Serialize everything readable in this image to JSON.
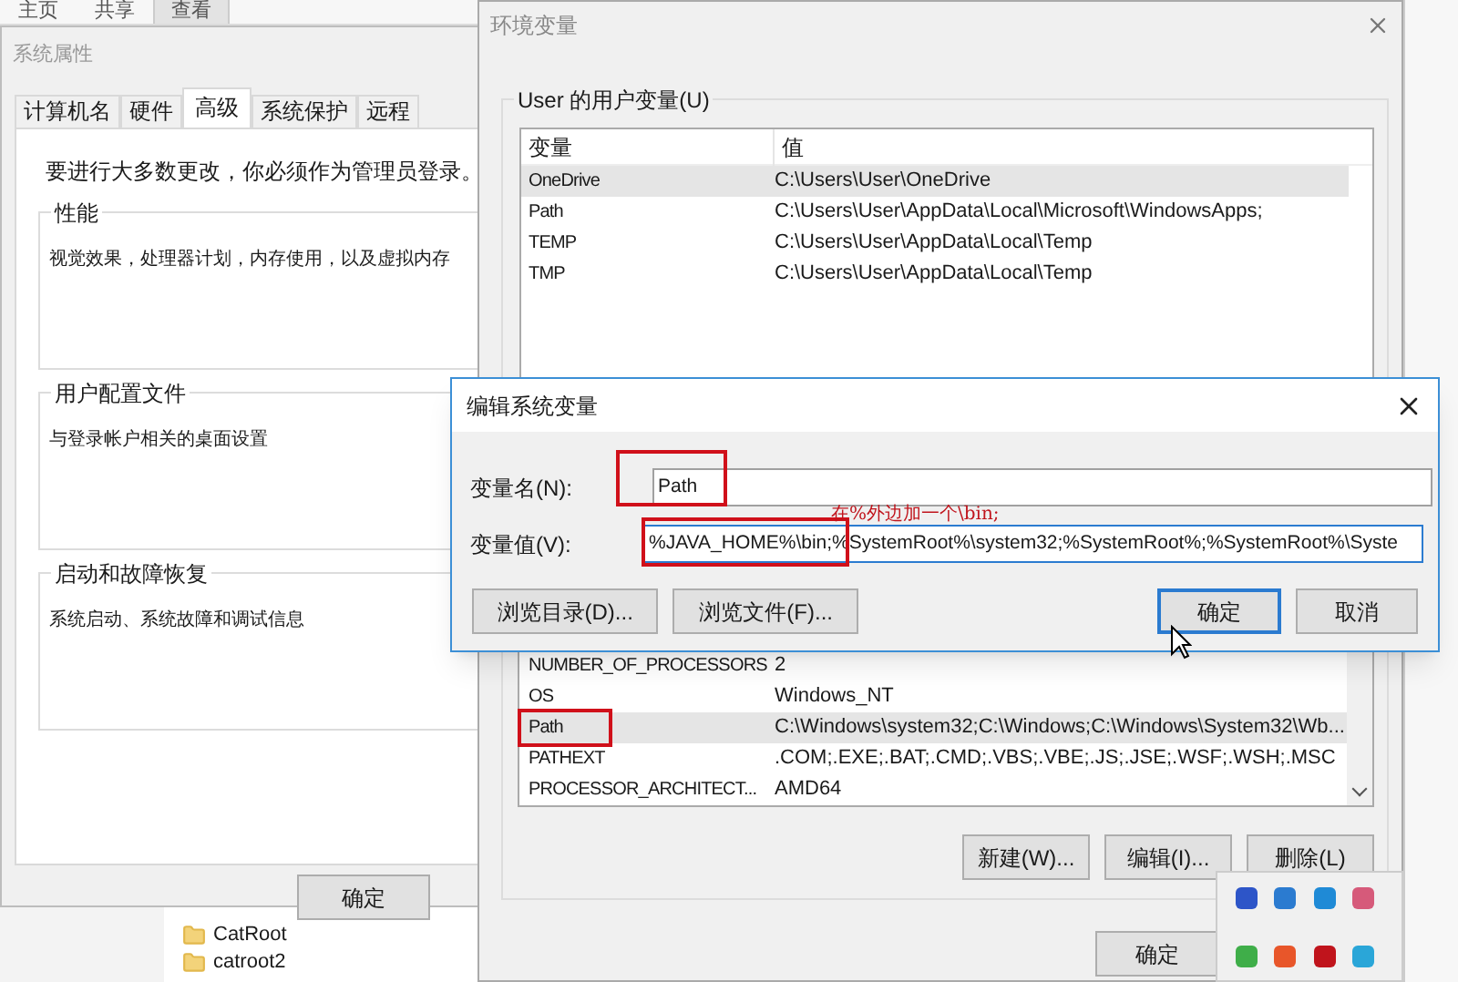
{
  "explorer": {
    "ribbon_tabs": [
      {
        "label": "主页",
        "selected": false
      },
      {
        "label": "共享",
        "selected": false
      },
      {
        "label": "查看",
        "selected": true
      }
    ],
    "folders": [
      "CatRoot",
      "catroot2"
    ]
  },
  "system_properties": {
    "title": "系统属性",
    "tabs": [
      {
        "label": "计算机名",
        "selected": false
      },
      {
        "label": "硬件",
        "selected": false
      },
      {
        "label": "高级",
        "selected": true
      },
      {
        "label": "系统保护",
        "selected": false
      },
      {
        "label": "远程",
        "selected": false
      }
    ],
    "notice": "要进行大多数更改，你必须作为管理员登录。",
    "groups": [
      {
        "title": "性能",
        "description": "视觉效果，处理器计划，内存使用，以及虚拟内存"
      },
      {
        "title": "用户配置文件",
        "description": "与登录帐户相关的桌面设置"
      },
      {
        "title": "启动和故障恢复",
        "description": "系统启动、系统故障和调试信息"
      }
    ],
    "buttons": [
      "确定"
    ]
  },
  "environment_variables": {
    "title": "环境变量",
    "user_group": "User 的用户变量(U)",
    "user_table": {
      "columns": [
        "变量",
        "值"
      ],
      "rows": [
        {
          "name": "OneDrive",
          "value": "C:\\Users\\User\\OneDrive",
          "selected": true,
          "highlighted": false
        },
        {
          "name": "Path",
          "value": "C:\\Users\\User\\AppData\\Local\\Microsoft\\WindowsApps;",
          "selected": false,
          "highlighted": false
        },
        {
          "name": "TEMP",
          "value": "C:\\Users\\User\\AppData\\Local\\Temp",
          "selected": false,
          "highlighted": false
        },
        {
          "name": "TMP",
          "value": "C:\\Users\\User\\AppData\\Local\\Temp",
          "selected": false,
          "highlighted": false
        }
      ]
    },
    "system_table": {
      "rows": [
        {
          "name": "NUMBER_OF_PROCESSORS",
          "value": "2",
          "selected": false,
          "highlighted": false
        },
        {
          "name": "OS",
          "value": "Windows_NT",
          "selected": false,
          "highlighted": false
        },
        {
          "name": "Path",
          "value": "C:\\Windows\\system32;C:\\Windows;C:\\Windows\\System32\\Wb...",
          "selected": true,
          "highlighted": true
        },
        {
          "name": "PATHEXT",
          "value": ".COM;.EXE;.BAT;.CMD;.VBS;.VBE;.JS;.JSE;.WSF;.WSH;.MSC",
          "selected": false,
          "highlighted": false
        },
        {
          "name": "PROCESSOR_ARCHITECT...",
          "value": "AMD64",
          "selected": false,
          "highlighted": false
        }
      ]
    },
    "system_buttons": [
      "新建(W)...",
      "编辑(I)...",
      "删除(L)"
    ],
    "buttons": [
      "确定"
    ]
  },
  "edit_dialog": {
    "title": "编辑系统变量",
    "name_field": {
      "label": "变量名(N):",
      "value": "Path",
      "highlighted": true,
      "focused": false
    },
    "value_field": {
      "label": "变量值(V):",
      "value": "%JAVA_HOME%\\bin;%SystemRoot%\\system32;%SystemRoot%;%SystemRoot%\\Syste",
      "highlighted": true,
      "focused": true
    },
    "annotation": "在%外边加一个\\bin;",
    "buttons": [
      {
        "label": "浏览目录(D)...",
        "focused": false
      },
      {
        "label": "浏览文件(F)...",
        "focused": false
      },
      {
        "label": "确定",
        "focused": true
      },
      {
        "label": "取消",
        "focused": false
      }
    ]
  }
}
